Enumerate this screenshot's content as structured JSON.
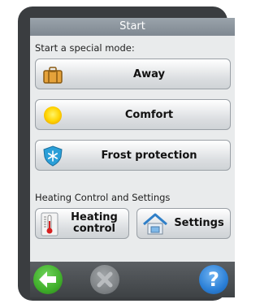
{
  "title": "Start",
  "special_mode": {
    "heading": "Start a special mode:",
    "buttons": [
      {
        "label": "Away",
        "icon": "suitcase-icon"
      },
      {
        "label": "Comfort",
        "icon": "sun-icon"
      },
      {
        "label": "Frost protection",
        "icon": "snowflake-shield-icon"
      }
    ]
  },
  "heating": {
    "heading": "Heating Control and Settings",
    "control_label": "Heating control",
    "settings_label": "Settings"
  },
  "bottom": {
    "back_icon": "back-arrow-icon",
    "cancel_icon": "cancel-icon",
    "help_icon": "help-icon",
    "help_glyph": "?"
  },
  "colors": {
    "back": "#3fae2a",
    "help": "#2b7fd6",
    "cancel_disabled": "#7d8184"
  }
}
